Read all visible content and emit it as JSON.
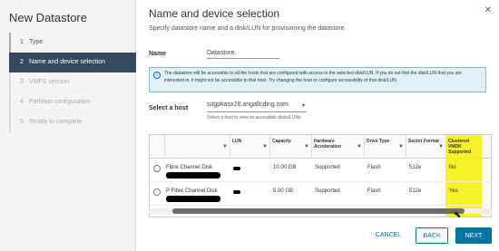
{
  "wizard": {
    "title": "New Datastore",
    "steps": [
      {
        "num": "1",
        "label": "Type"
      },
      {
        "num": "2",
        "label": "Name and device selection"
      },
      {
        "num": "3",
        "label": "VMFS version"
      },
      {
        "num": "4",
        "label": "Partition configuration"
      },
      {
        "num": "5",
        "label": "Ready to complete"
      }
    ]
  },
  "page": {
    "title": "Name and device selection",
    "subtitle": "Specify datastore name and a disk/LUN for provisioning the datastore.",
    "name_label": "Name",
    "name_value": "Datastore",
    "info_text": "The datastore will be accessible to all the hosts that are configured with access to the selected disk/LUN. If you do not find the disk/LUN that you are interested in, it might not be accessible to that host. Try changing the host or configure accessibility of that disk/LUN.",
    "host_label": "Select a host",
    "host_value": "sogpkasx28.angallcding.com",
    "host_hint": "Select a host to view its accessible disks/LUNs"
  },
  "grid": {
    "columns": [
      "LUN",
      "Capacity",
      "Hardware Acceleration",
      "Drive Type",
      "Sector Format",
      "Clustered VMDK Supported"
    ],
    "rows": [
      {
        "name": "Fibre Channel Disk",
        "lun": "",
        "capacity": "10.00 GB",
        "accel": "Supported",
        "drive": "Flash",
        "sector": "512e",
        "clustered": "No"
      },
      {
        "name": "P Fibre Channel Disk",
        "lun": "",
        "capacity": "5.00 GB",
        "accel": "Supported",
        "drive": "Flash",
        "sector": "512e",
        "clustered": "Yes"
      }
    ]
  },
  "footer": {
    "cancel": "CANCEL",
    "back": "BACK",
    "next": "NEXT"
  },
  "colors": {
    "accent": "#0072a3",
    "active_step": "#354a5e",
    "highlight": "#f4f000"
  }
}
